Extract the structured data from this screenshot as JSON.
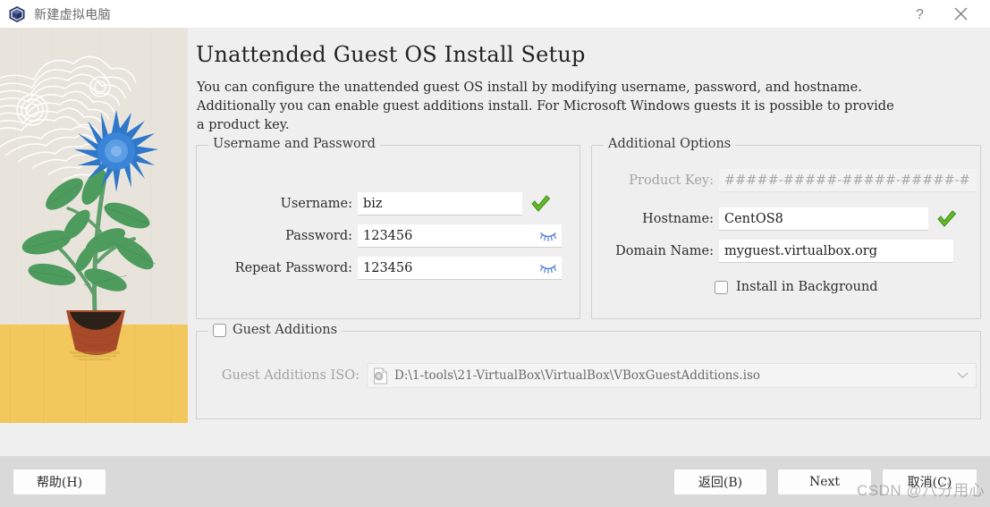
{
  "window": {
    "title": "新建虚拟电脑",
    "icon": "virtualbox-cube-icon",
    "help_label": "?",
    "close_label": "✕"
  },
  "page": {
    "title": "Unattended Guest OS Install Setup",
    "description": "You can configure the unattended guest OS install by modifying username, password, and hostname. Additionally you can enable guest additions install. For Microsoft Windows guests it is possible to provide a product key."
  },
  "username_password_group": {
    "title": "Username and Password",
    "username": {
      "label": "Username:",
      "value": "biz",
      "status_icon": "green-check-icon"
    },
    "password": {
      "label": "Password:",
      "value": "123456",
      "reveal_icon": "eye-closed-icon"
    },
    "repeat_password": {
      "label": "Repeat Password:",
      "value": "123456",
      "reveal_icon": "eye-closed-icon"
    }
  },
  "additional_options_group": {
    "title": "Additional Options",
    "product_key": {
      "label": "Product Key:",
      "value": "#####-#####-#####-#####-#####",
      "disabled": true
    },
    "hostname": {
      "label": "Hostname:",
      "value": "CentOS8",
      "status_icon": "green-check-icon"
    },
    "domain_name": {
      "label": "Domain Name:",
      "value": "myguest.virtualbox.org"
    },
    "install_in_background": {
      "label": "Install in Background",
      "checked": false
    }
  },
  "guest_additions_group": {
    "title": "Guest Additions",
    "checked": false,
    "iso": {
      "label": "Guest Additions ISO:",
      "value": "D:\\1-tools\\21-VirtualBox\\VirtualBox\\VBoxGuestAdditions.iso",
      "icon": "iso-disc-icon",
      "arrow_icon": "chevron-down-icon",
      "disabled": true
    }
  },
  "footer": {
    "help": "帮助(H)",
    "back": "返回(B)",
    "next": "Next",
    "cancel": "取消(C)"
  },
  "watermark": "CSDN @八分用心",
  "colors": {
    "accent_check": "#64bb28",
    "eye_icon": "#5b87d6",
    "window_bg": "#efefef",
    "footer_bg": "#d9d9d9",
    "art_sky": "#e8e4dc",
    "art_ground": "#f2c85c",
    "art_flower": "#2e77c9",
    "art_leaf": "#4e9b5e",
    "art_pot": "#a84a2a"
  }
}
